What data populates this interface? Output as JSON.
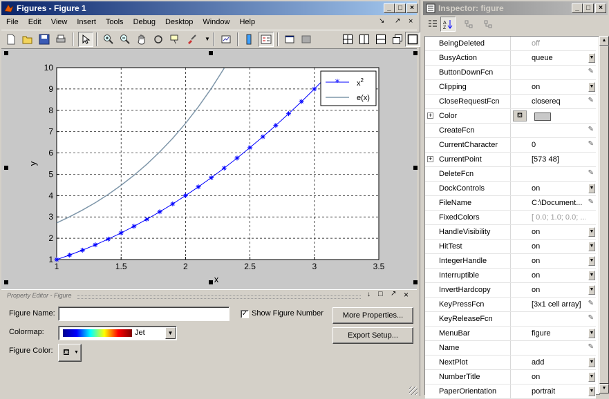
{
  "figures_window": {
    "title": "Figures - Figure 1",
    "menu": [
      "File",
      "Edit",
      "View",
      "Insert",
      "Tools",
      "Debug",
      "Desktop",
      "Window",
      "Help"
    ]
  },
  "chart_data": {
    "type": "line",
    "xlabel": "x",
    "ylabel": "y",
    "xlim": [
      1,
      3.5
    ],
    "ylim": [
      1,
      10
    ],
    "grid": true,
    "legend_position": "top-right",
    "xticks": [
      "1",
      "1.5",
      "2",
      "2.5",
      "3",
      "3.5"
    ],
    "yticks": [
      "1",
      "2",
      "3",
      "4",
      "5",
      "6",
      "7",
      "8",
      "9",
      "10"
    ],
    "series": [
      {
        "name": "x",
        "name_superscript": "2",
        "color": "#0000ff",
        "marker": "*",
        "x": [
          1.0,
          1.1,
          1.2,
          1.3,
          1.4,
          1.5,
          1.6,
          1.7,
          1.8,
          1.9,
          2.0,
          2.1,
          2.2,
          2.3,
          2.4,
          2.5,
          2.6,
          2.7,
          2.8,
          2.9,
          3.0,
          3.1
        ],
        "y": [
          1.0,
          1.21,
          1.44,
          1.69,
          1.96,
          2.25,
          2.56,
          2.89,
          3.24,
          3.61,
          4.0,
          4.41,
          4.84,
          5.29,
          5.76,
          6.25,
          6.76,
          7.29,
          7.84,
          8.41,
          9.0,
          9.61
        ]
      },
      {
        "name": "e(x)",
        "color": "#7f97aa",
        "marker": "",
        "x": [
          1.0,
          1.1,
          1.2,
          1.3,
          1.4,
          1.5,
          1.6,
          1.7,
          1.8,
          1.9,
          2.0,
          2.1,
          2.2,
          2.3
        ],
        "y": [
          2.718,
          3.004,
          3.32,
          3.669,
          4.055,
          4.482,
          4.953,
          5.474,
          6.05,
          6.686,
          7.389,
          8.166,
          9.025,
          9.974
        ]
      }
    ]
  },
  "property_editor": {
    "title": "Property Editor - Figure",
    "figure_name_label": "Figure Name:",
    "figure_name_value": "",
    "show_figure_number_label": "Show Figure Number",
    "show_figure_number_checked": true,
    "colormap_label": "Colormap:",
    "colormap_value": "Jet",
    "figure_color_label": "Figure Color:",
    "more_properties_label": "More Properties...",
    "export_setup_label": "Export Setup..."
  },
  "inspector": {
    "title": "Inspector: figure",
    "properties": [
      {
        "name": "BeingDeleted",
        "value": "off",
        "control": "none",
        "muted": true
      },
      {
        "name": "BusyAction",
        "value": "queue",
        "control": "dropdown"
      },
      {
        "name": "ButtonDownFcn",
        "value": "",
        "control": "edit"
      },
      {
        "name": "Clipping",
        "value": "on",
        "control": "dropdown"
      },
      {
        "name": "CloseRequestFcn",
        "value": "closereq",
        "control": "edit"
      },
      {
        "name": "Color",
        "value": "",
        "control": "color",
        "expandable": true
      },
      {
        "name": "CreateFcn",
        "value": "",
        "control": "edit"
      },
      {
        "name": "CurrentCharacter",
        "value": "0",
        "control": "edit"
      },
      {
        "name": "CurrentPoint",
        "value": "[573 48]",
        "control": "none",
        "expandable": true
      },
      {
        "name": "DeleteFcn",
        "value": "",
        "control": "edit"
      },
      {
        "name": "DockControls",
        "value": "on",
        "control": "dropdown"
      },
      {
        "name": "FileName",
        "value": "C:\\Document...",
        "control": "edit"
      },
      {
        "name": "FixedColors",
        "value": "[ 0.0; 1.0; 0.0; ...",
        "control": "none",
        "muted": true
      },
      {
        "name": "HandleVisibility",
        "value": "on",
        "control": "dropdown"
      },
      {
        "name": "HitTest",
        "value": "on",
        "control": "dropdown"
      },
      {
        "name": "IntegerHandle",
        "value": "on",
        "control": "dropdown"
      },
      {
        "name": "Interruptible",
        "value": "on",
        "control": "dropdown"
      },
      {
        "name": "InvertHardcopy",
        "value": "on",
        "control": "dropdown"
      },
      {
        "name": "KeyPressFcn",
        "value": "[3x1  cell array]",
        "control": "edit"
      },
      {
        "name": "KeyReleaseFcn",
        "value": "",
        "control": "edit"
      },
      {
        "name": "MenuBar",
        "value": "figure",
        "control": "dropdown"
      },
      {
        "name": "Name",
        "value": "",
        "control": "edit"
      },
      {
        "name": "NextPlot",
        "value": "add",
        "control": "dropdown"
      },
      {
        "name": "NumberTitle",
        "value": "on",
        "control": "dropdown"
      },
      {
        "name": "PaperOrientation",
        "value": "portrait",
        "control": "dropdown"
      }
    ]
  }
}
